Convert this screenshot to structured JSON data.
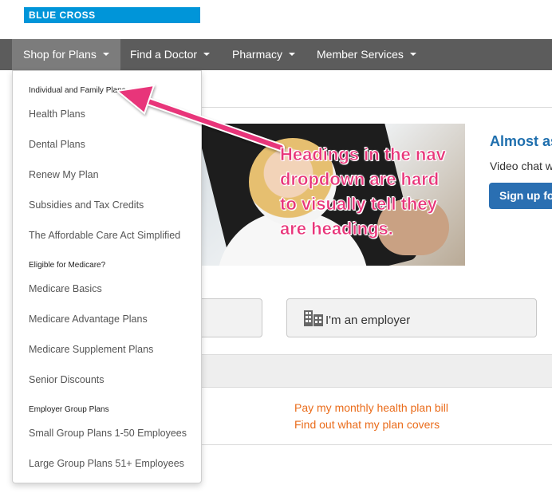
{
  "brand": {
    "logo_text": "BLUE CROSS",
    "color": "#0095d9"
  },
  "nav": {
    "items": [
      {
        "label": "Shop for Plans",
        "active": true
      },
      {
        "label": "Find a Doctor"
      },
      {
        "label": "Pharmacy"
      },
      {
        "label": "Member Services"
      }
    ]
  },
  "dropdown": {
    "rows": [
      {
        "type": "heading",
        "label": "Individual and Family Plans"
      },
      {
        "type": "item",
        "label": "Health Plans"
      },
      {
        "type": "item",
        "label": "Dental Plans"
      },
      {
        "type": "item",
        "label": "Renew My Plan"
      },
      {
        "type": "item",
        "label": "Subsidies and Tax Credits"
      },
      {
        "type": "item",
        "label": "The Affordable Care Act Simplified"
      },
      {
        "type": "heading",
        "label": "Eligible for Medicare?"
      },
      {
        "type": "item",
        "label": "Medicare Basics"
      },
      {
        "type": "item",
        "label": "Medicare Advantage Plans"
      },
      {
        "type": "item",
        "label": "Medicare Supplement Plans"
      },
      {
        "type": "item",
        "label": "Senior Discounts"
      },
      {
        "type": "heading",
        "label": "Employer Group Plans"
      },
      {
        "type": "item",
        "label": "Small Group Plans 1-50 Employees"
      },
      {
        "type": "item",
        "label": "Large Group Plans 51+ Employees"
      }
    ]
  },
  "promo": {
    "title": "Almost as",
    "text": "Video chat w",
    "button_label": "Sign up fo"
  },
  "audience": {
    "employer_label": "I'm an employer"
  },
  "links": [
    {
      "label": "Pay my monthly health plan bill"
    },
    {
      "label": "Find out what my plan covers"
    }
  ],
  "annotation": {
    "text": "Headings in the nav dropdown are hard to visually tell they are headings.",
    "color": "#e8357a"
  }
}
